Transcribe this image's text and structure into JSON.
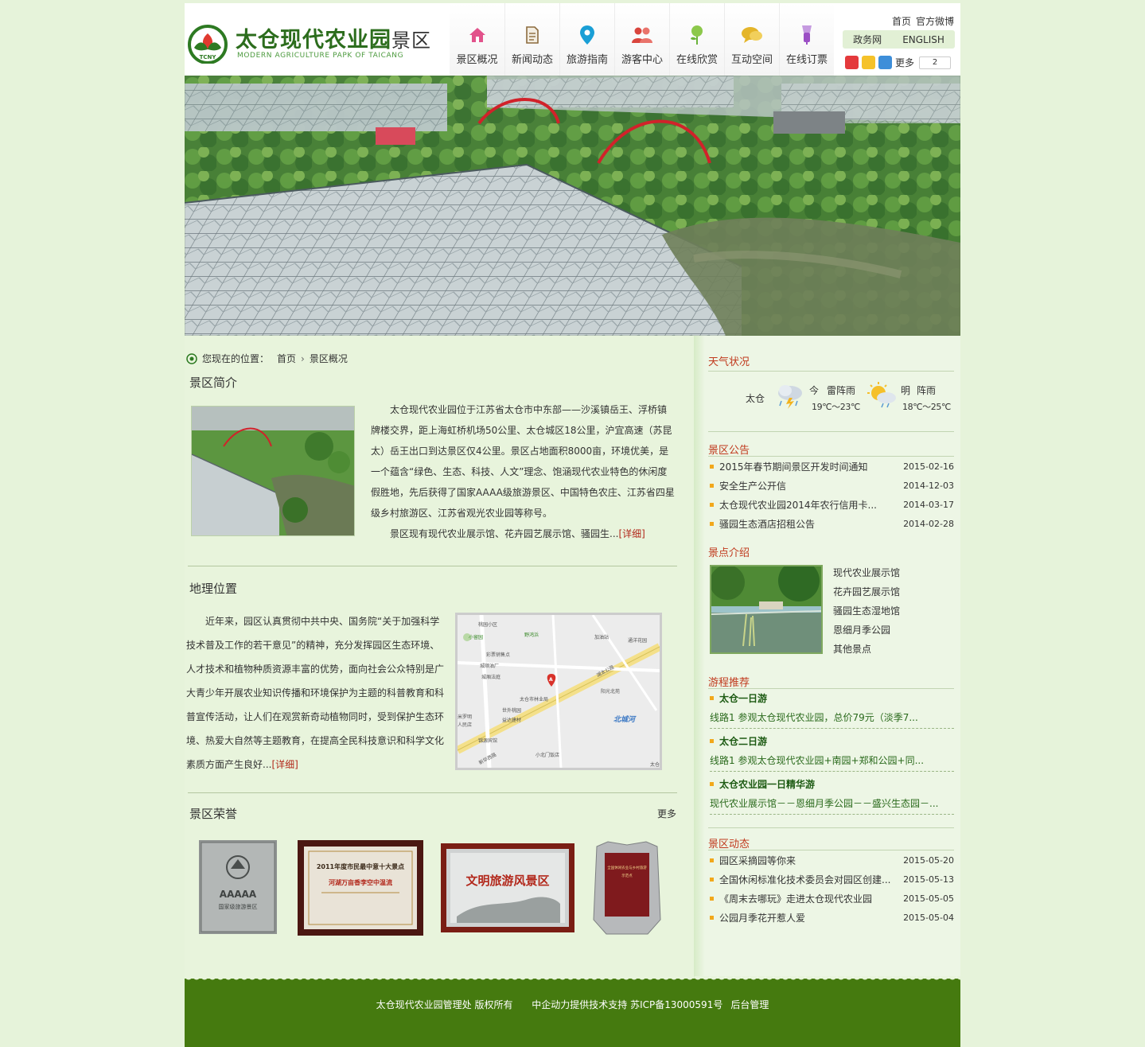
{
  "header": {
    "logo_cn": "太仓现代农业园",
    "logo_cn_suffix": "景区",
    "logo_en": "MODERN AGRICULTURE PAPK OF TAICANG",
    "logo_badge": "TCNY",
    "nav": [
      {
        "label": "景区概况",
        "icon": "house-icon",
        "color": "#e2528b"
      },
      {
        "label": "新闻动态",
        "icon": "document-icon",
        "color": "#8c6b3e"
      },
      {
        "label": "旅游指南",
        "icon": "map-pin-icon",
        "color": "#1a9fd6"
      },
      {
        "label": "游客中心",
        "icon": "people-icon",
        "color": "#d9453d"
      },
      {
        "label": "在线欣赏",
        "icon": "plant-icon",
        "color": "#6bb33b"
      },
      {
        "label": "互动空间",
        "icon": "chat-bubble-icon",
        "color": "#e4b52a"
      },
      {
        "label": "在线订票",
        "icon": "ticket-icon",
        "color": "#9b4fc5"
      }
    ],
    "top_links": [
      "首页",
      "官方微博"
    ],
    "lang_links": [
      "政务网",
      "ENGLISH"
    ],
    "share_more": "更多",
    "share_count": "2"
  },
  "breadcrumb": {
    "prefix": "您现在的位置：",
    "items": [
      "首页",
      "景区概况"
    ]
  },
  "intro": {
    "title": "景区简介",
    "paragraph1": "太仓现代农业园位于江苏省太仓市中东部——沙溪镇岳王、浮桥镇牌楼交界，距上海虹桥机场50公里、太仓城区18公里，沪宜高速（苏昆太）岳王出口到达景区仅4公里。景区占地面积8000亩，环境优美，是一个蕴含“绿色、生态、科技、人文”理念、饱涵现代农业特色的休闲度假胜地，先后获得了国家AAAA级旅游景区、中国特色农庄、江苏省四星级乡村旅游区、江苏省观光农业园等称号。",
    "paragraph2": "景区现有现代农业展示馆、花卉园艺展示馆、骚园生...",
    "detail": "[详细]"
  },
  "geo": {
    "title": "地理位置",
    "text": "近年来，园区认真贯彻中共中央、国务院“关于加强科学技术普及工作的若干意见”的精神，充分发挥园区生态环境、人才技术和植物种质资源丰富的优势，面向社会公众特别是广大青少年开展农业知识传播和环境保护为主题的科普教育和科普宣传活动，让人们在观赏新奇动植物同时，受到保护生态环境、热爱大自然等主题教育，在提高全民科技意识和科学文化素质方面产生良好...",
    "detail": "[详细]",
    "map_labels": [
      "桃园小区",
      "小留园",
      "野鸿浜",
      "加油站",
      "通洋花园",
      "彩票销售点",
      "城顺油厂",
      "城厢法庭",
      "湖太公路",
      "阳光北苑",
      "太仓市林业局",
      "世外桃园",
      "北城河",
      "益达建材",
      "米罗明",
      "人民店",
      "锦源宾馆",
      "小北门饭店",
      "新华西路",
      "太仓"
    ],
    "map_marker": "A"
  },
  "honors": {
    "title": "景区荣誉",
    "more": "更多",
    "awards": [
      {
        "line1": "AAAAA",
        "line2": "国家级旅游景区"
      },
      {
        "line1": "2011年度市民最中意十大景点",
        "line2": "河湖万亩香李空中温流"
      },
      {
        "line1": "文明旅游风景区",
        "line2": ""
      },
      {
        "line1": "全国休闲农业与乡村旅游",
        "line2": "示范点"
      }
    ]
  },
  "weather": {
    "title": "天气状况",
    "city": "太仓",
    "today_label": "今",
    "today_desc": "雷阵雨",
    "today_temp": "19℃～23℃",
    "tomorrow_label": "明",
    "tomorrow_desc": "阵雨",
    "tomorrow_temp": "18℃～25℃"
  },
  "notices": {
    "title": "景区公告",
    "items": [
      {
        "title": "2015年春节期间景区开发时间通知",
        "date": "2015-02-16"
      },
      {
        "title": "安全生产公开信",
        "date": "2014-12-03"
      },
      {
        "title": "太仓现代农业园2014年农行信用卡...",
        "date": "2014-03-17"
      },
      {
        "title": "骚园生态酒店招租公告",
        "date": "2014-02-28"
      }
    ]
  },
  "spots": {
    "title": "景点介绍",
    "items": [
      "现代农业展示馆",
      "花卉园艺展示馆",
      "骚园生态湿地馆",
      "恩细月季公园",
      "其他景点"
    ]
  },
  "routes": {
    "title": "游程推荐",
    "items": [
      {
        "title": "太仓一日游",
        "desc": "线路1 参观太仓现代农业园，总价79元（淡季7..."
      },
      {
        "title": "太仓二日游",
        "desc": "线路1 参观太仓现代农业园+南园+郑和公园+同..."
      },
      {
        "title": "太仓农业园一日精华游",
        "desc": "现代农业展示馆－－恩细月季公园－－盛兴生态园－..."
      }
    ]
  },
  "news": {
    "title": "景区动态",
    "items": [
      {
        "title": "园区采摘园等你来",
        "date": "2015-05-20"
      },
      {
        "title": "全国休闲标准化技术委员会对园区创建...",
        "date": "2015-05-13"
      },
      {
        "title": "《周末去哪玩》走进太仓现代农业园",
        "date": "2015-05-05"
      },
      {
        "title": "公园月季花开惹人爱",
        "date": "2015-05-04"
      }
    ]
  },
  "footer": {
    "copyright": "太仓现代农业园管理处 版权所有",
    "tech": "中企动力提供技术支持 苏ICP备13000591号",
    "admin": "后台管理"
  }
}
